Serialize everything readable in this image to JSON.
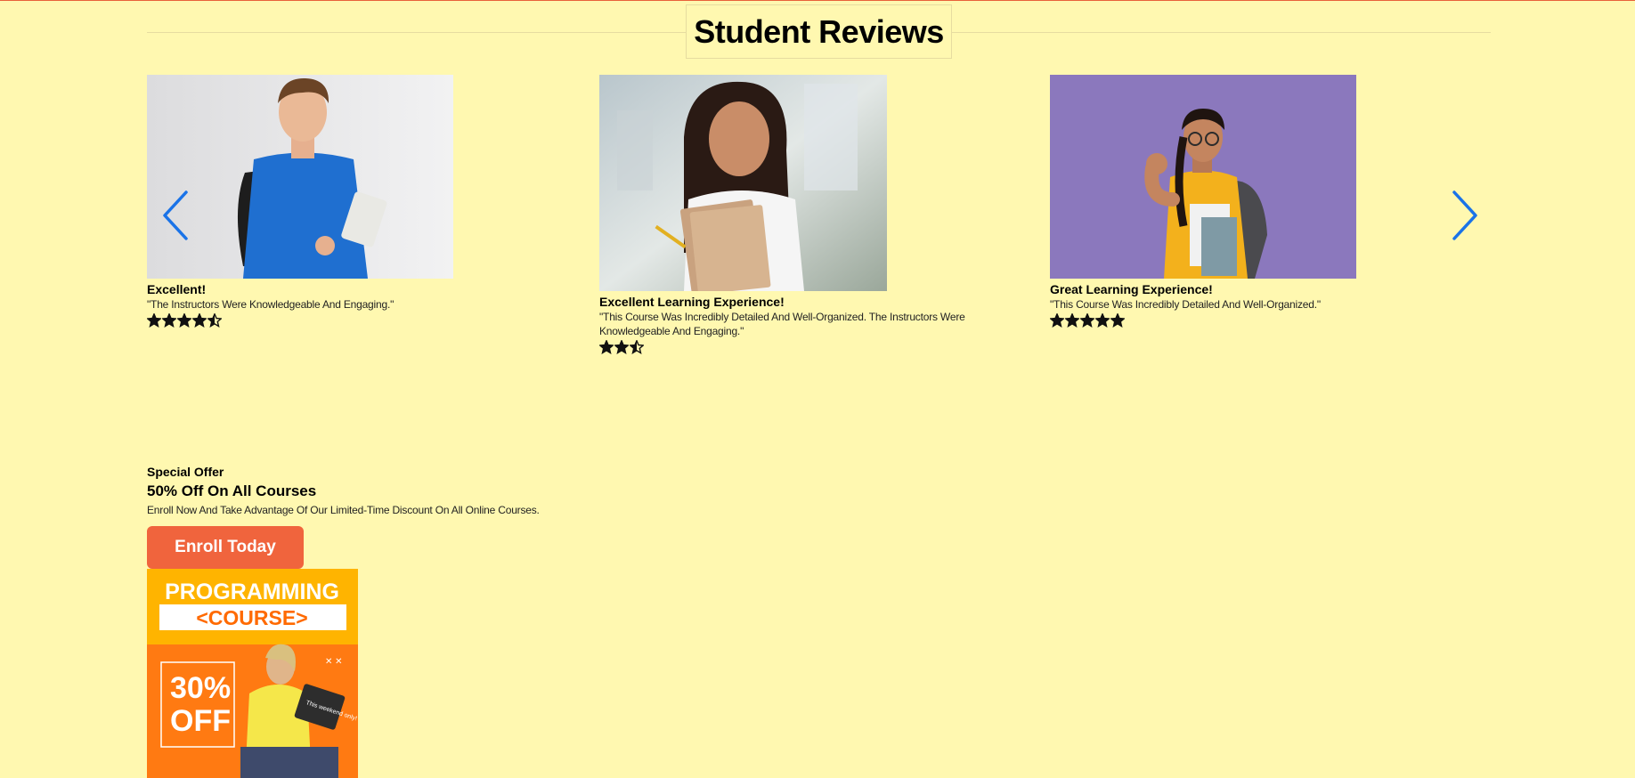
{
  "section": {
    "title": "Student Reviews"
  },
  "carousel": {
    "prev_icon": "chevron-left-icon",
    "next_icon": "chevron-right-icon",
    "arrow_color": "#1a73e8",
    "reviews": [
      {
        "title": "Excellent!",
        "quote": "\"The Instructors Were Knowledgeable And Engaging.\"",
        "rating": 4.5
      },
      {
        "title": "Excellent Learning Experience!",
        "quote": "\"This Course Was Incredibly Detailed And Well-Organized. The Instructors Were Knowledgeable And Engaging.\"",
        "rating": 2.5
      },
      {
        "title": "Great Learning Experience!",
        "quote": "\"This Course Was Incredibly Detailed And Well-Organized.\"",
        "rating": 5
      }
    ]
  },
  "offer": {
    "eyebrow": "Special Offer",
    "headline": "50% Off On All Courses",
    "description": "Enroll Now And Take Advantage Of Our Limited-Time Discount On All Online Courses.",
    "button_label": "Enroll Today",
    "button_color": "#f0643d",
    "banner": {
      "line1": "PROGRAMMING",
      "line2": "<COURSE>",
      "discount_1": "30%",
      "discount_2": "OFF",
      "note": "This weekend only!"
    }
  }
}
